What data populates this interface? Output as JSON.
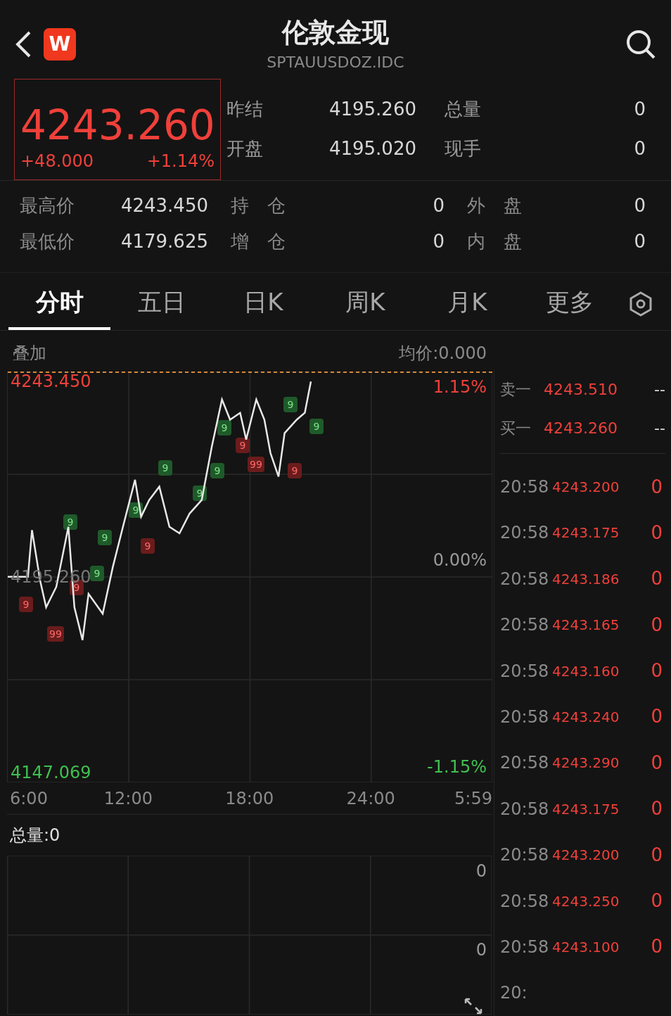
{
  "header": {
    "logo": "W",
    "title": "伦敦金现",
    "code": "SPTAUUSDOZ.IDC"
  },
  "quote": {
    "price": "4243.260",
    "change": "+48.000",
    "change_pct": "+1.14%"
  },
  "stats": [
    {
      "label": "昨结",
      "value": "4195.260"
    },
    {
      "label": "总量",
      "value": "0"
    },
    {
      "label": "开盘",
      "value": "4195.020"
    },
    {
      "label": "现手",
      "value": "0"
    }
  ],
  "stats_lower": [
    {
      "label": "最高价",
      "value": "4243.450"
    },
    {
      "label": "持　仓",
      "value": "0"
    },
    {
      "label": "外　盘",
      "value": "0"
    },
    {
      "label": "最低价",
      "value": "4179.625"
    },
    {
      "label": "增　仓",
      "value": "0"
    },
    {
      "label": "内　盘",
      "value": "0"
    }
  ],
  "tabs": [
    {
      "label": "分时",
      "selected": true
    },
    {
      "label": "五日",
      "selected": false
    },
    {
      "label": "日K",
      "selected": false
    },
    {
      "label": "周K",
      "selected": false
    },
    {
      "label": "月K",
      "selected": false
    },
    {
      "label": "更多",
      "selected": false
    }
  ],
  "chart": {
    "overlay": "叠加",
    "avg_price": "均价:0.000",
    "pct_high": "1.15%",
    "pct_mid": "0.00%",
    "pct_low": "-1.15%",
    "x_end_label": "5:59",
    "chart_data": {
      "type": "line",
      "grid": true,
      "xlim": [
        6,
        29.98
      ],
      "ylim": [
        4144.64,
        4245.88
      ],
      "xticks": [
        {
          "value": 6,
          "label": "6:00"
        },
        {
          "value": 12,
          "label": "12:00"
        },
        {
          "value": 18,
          "label": "18:00"
        },
        {
          "value": 24,
          "label": "24:00"
        }
      ],
      "yticks": [
        {
          "value": 4243.45,
          "label": "4243.450"
        },
        {
          "value": 4195.26,
          "label": "4195.260"
        },
        {
          "value": 4147.069,
          "label": "4147.069"
        }
      ],
      "x": [
        6,
        7.0,
        7.2,
        7.6,
        7.9,
        8.4,
        9.0,
        9.3,
        9.7,
        10.0,
        10.7,
        11.2,
        11.7,
        12.3,
        12.6,
        13.0,
        13.5,
        14.0,
        14.5,
        15.0,
        15.6,
        16.1,
        16.6,
        17.0,
        17.5,
        17.8,
        18.3,
        18.7,
        19.0,
        19.4,
        19.7,
        20.3,
        20.7,
        21.0
      ],
      "series": [
        {
          "color": "#e8e8e8",
          "values": [
            4195.3,
            4195.3,
            4206.8,
            4194.4,
            4187.8,
            4192.8,
            4207.6,
            4187.8,
            4179.7,
            4191.1,
            4186.2,
            4197.7,
            4207.6,
            4219.2,
            4210.1,
            4214.2,
            4217.5,
            4207.6,
            4206.0,
            4210.9,
            4214.2,
            4227.4,
            4239.0,
            4234.0,
            4235.7,
            4229.1,
            4239.0,
            4234.0,
            4225.8,
            4220.0,
            4230.7,
            4234.0,
            4235.7,
            4243.4
          ]
        }
      ]
    },
    "markers": [
      {
        "label": "9",
        "kind": "buy"
      },
      {
        "label": "9",
        "kind": "buy"
      },
      {
        "label": "9",
        "kind": "buy"
      },
      {
        "label": "9",
        "kind": "buy"
      },
      {
        "label": "9",
        "kind": "buy"
      },
      {
        "label": "9",
        "kind": "buy"
      },
      {
        "label": "9",
        "kind": "buy"
      },
      {
        "label": "9",
        "kind": "buy"
      },
      {
        "label": "9",
        "kind": "buy"
      },
      {
        "label": "9",
        "kind": "buy"
      },
      {
        "label": "9",
        "kind": "sell"
      },
      {
        "label": "99",
        "kind": "sell"
      },
      {
        "label": "9",
        "kind": "sell"
      },
      {
        "label": "9",
        "kind": "sell"
      },
      {
        "label": "9",
        "kind": "sell"
      },
      {
        "label": "99",
        "kind": "sell"
      },
      {
        "label": "9",
        "kind": "sell"
      }
    ]
  },
  "volume": {
    "label": "总量:0",
    "axis_labels": [
      "0",
      "0"
    ]
  },
  "order_book": {
    "quotes": [
      {
        "label": "卖一",
        "price": "4243.510",
        "volume": "--"
      },
      {
        "label": "买一",
        "price": "4243.260",
        "volume": "--"
      }
    ],
    "trades": [
      {
        "time": "20:58",
        "price": "4243.200",
        "volume": "0"
      },
      {
        "time": "20:58",
        "price": "4243.175",
        "volume": "0"
      },
      {
        "time": "20:58",
        "price": "4243.186",
        "volume": "0"
      },
      {
        "time": "20:58",
        "price": "4243.165",
        "volume": "0"
      },
      {
        "time": "20:58",
        "price": "4243.160",
        "volume": "0"
      },
      {
        "time": "20:58",
        "price": "4243.240",
        "volume": "0"
      },
      {
        "time": "20:58",
        "price": "4243.290",
        "volume": "0"
      },
      {
        "time": "20:58",
        "price": "4243.175",
        "volume": "0"
      },
      {
        "time": "20:58",
        "price": "4243.200",
        "volume": "0"
      },
      {
        "time": "20:58",
        "price": "4243.250",
        "volume": "0"
      },
      {
        "time": "20:58",
        "price": "4243.100",
        "volume": "0"
      },
      {
        "time": "20:"
      }
    ]
  }
}
